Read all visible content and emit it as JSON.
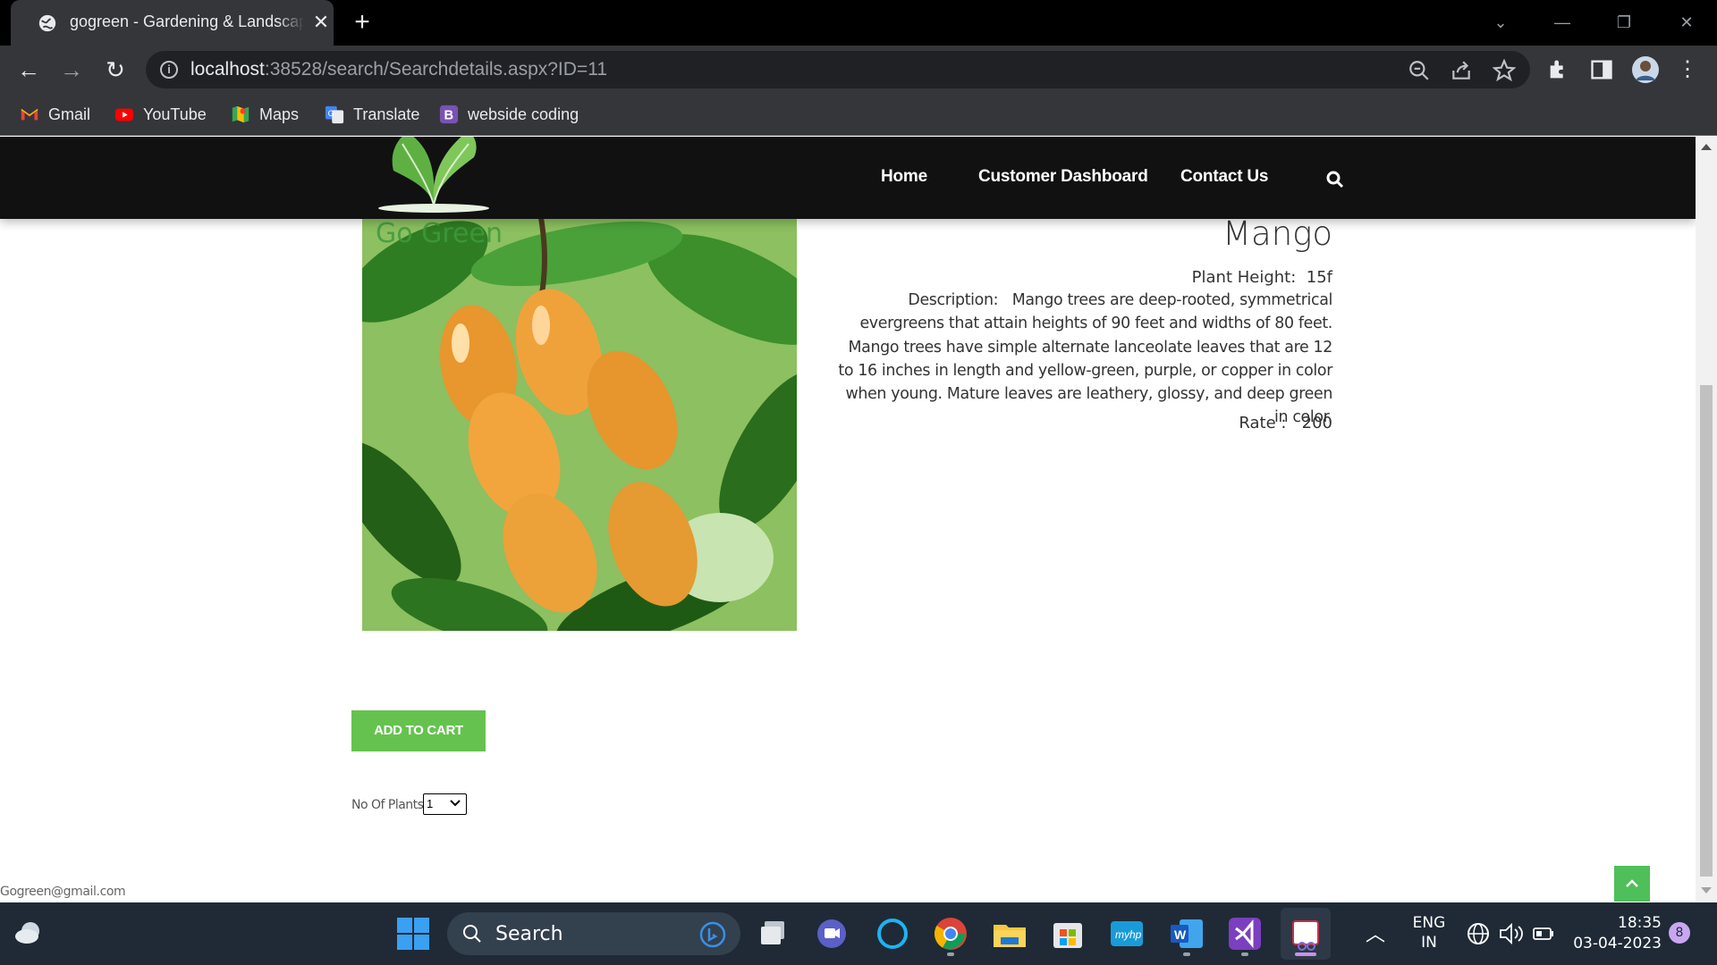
{
  "browser": {
    "tab_title": "gogreen - Gardening & Landscaping",
    "url_host": "localhost",
    "url_rest": ":38528/search/Searchdetails.aspx?ID=11"
  },
  "bookmarks": [
    {
      "label": "Gmail",
      "icon": "gmail-icon"
    },
    {
      "label": "YouTube",
      "icon": "youtube-icon"
    },
    {
      "label": "Maps",
      "icon": "maps-icon"
    },
    {
      "label": "Translate",
      "icon": "translate-icon"
    },
    {
      "label": "webside coding",
      "icon": "bootstrap-icon"
    }
  ],
  "site": {
    "logo_text": "Go Green",
    "nav": [
      "Home",
      "Customer Dashboard",
      "Contact Us"
    ]
  },
  "product": {
    "name": "Mango",
    "height_label": "Plant Height:",
    "height_value": "15f",
    "description_label": "Description:",
    "description": "Mango trees are deep-rooted, symmetrical evergreens that attain heights of 90 feet and widths of 80 feet. Mango trees have simple alternate lanceolate leaves that are 12 to 16 inches in length and yellow-green, purple, or copper in color when young. Mature leaves are leathery, glossy, and deep green in color.",
    "rate_label": "Rate :",
    "rate_value": "200",
    "add_to_cart": "ADD TO CART",
    "qty_label": "No Of Plants",
    "qty_value": "1"
  },
  "footer": {
    "email": "Gogreen@gmail.com"
  },
  "taskbar": {
    "search_label": "Search",
    "lang_line1": "ENG",
    "lang_line2": "IN",
    "time": "18:35",
    "date": "03-04-2023",
    "notification_count": "8"
  },
  "colors": {
    "accent_green": "#66c24f",
    "site_header": "#111111",
    "chrome_dark": "#35363a"
  }
}
